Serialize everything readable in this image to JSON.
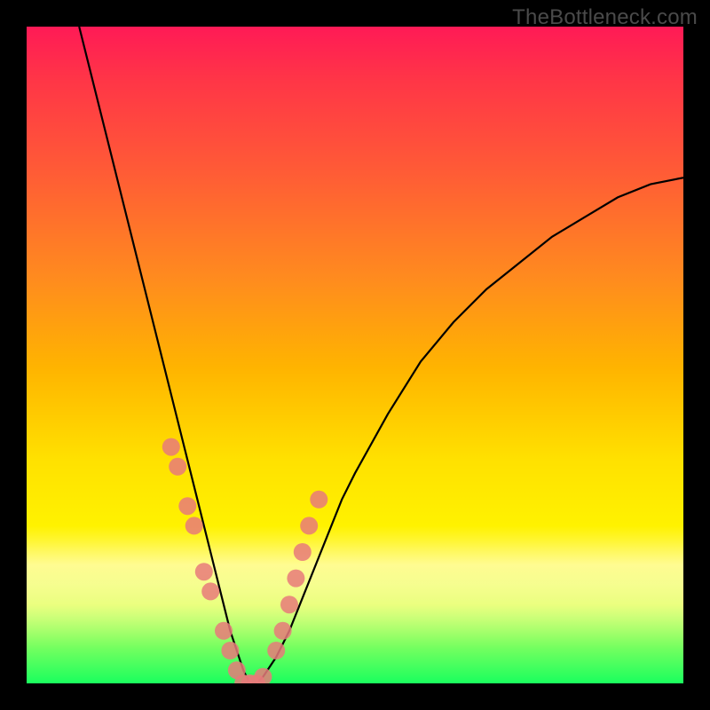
{
  "watermark": "TheBottleneck.com",
  "chart_data": {
    "type": "line",
    "title": "",
    "xlabel": "",
    "ylabel": "",
    "xlim": [
      0,
      100
    ],
    "ylim": [
      0,
      100
    ],
    "grid": false,
    "legend": false,
    "series": [
      {
        "name": "bottleneck-curve",
        "color": "#000000",
        "x": [
          8,
          10,
          12,
          14,
          16,
          18,
          20,
          22,
          24,
          26,
          28,
          30,
          31,
          32,
          33,
          34,
          35,
          36,
          38,
          40,
          42,
          44,
          46,
          48,
          50,
          55,
          60,
          65,
          70,
          75,
          80,
          85,
          90,
          95,
          100
        ],
        "y": [
          100,
          92,
          84,
          76,
          68,
          60,
          52,
          44,
          36,
          28,
          20,
          12,
          8,
          5,
          2,
          0,
          0,
          1,
          4,
          8,
          13,
          18,
          23,
          28,
          32,
          41,
          49,
          55,
          60,
          64,
          68,
          71,
          74,
          76,
          77
        ]
      },
      {
        "name": "highlight-dots",
        "color": "#e57373",
        "x": [
          22,
          23,
          24.5,
          25.5,
          27,
          28,
          30,
          31,
          32,
          33,
          34,
          35,
          36,
          38,
          39,
          40,
          41,
          42,
          43,
          44.5
        ],
        "y": [
          36,
          33,
          27,
          24,
          17,
          14,
          8,
          5,
          2,
          0,
          0,
          0,
          1,
          5,
          8,
          12,
          16,
          20,
          24,
          28
        ]
      }
    ]
  },
  "colors": {
    "frame": "#000000",
    "watermark_text": "#4a4a4a",
    "dot_fill": "#e77a7a",
    "curve": "#000000"
  }
}
